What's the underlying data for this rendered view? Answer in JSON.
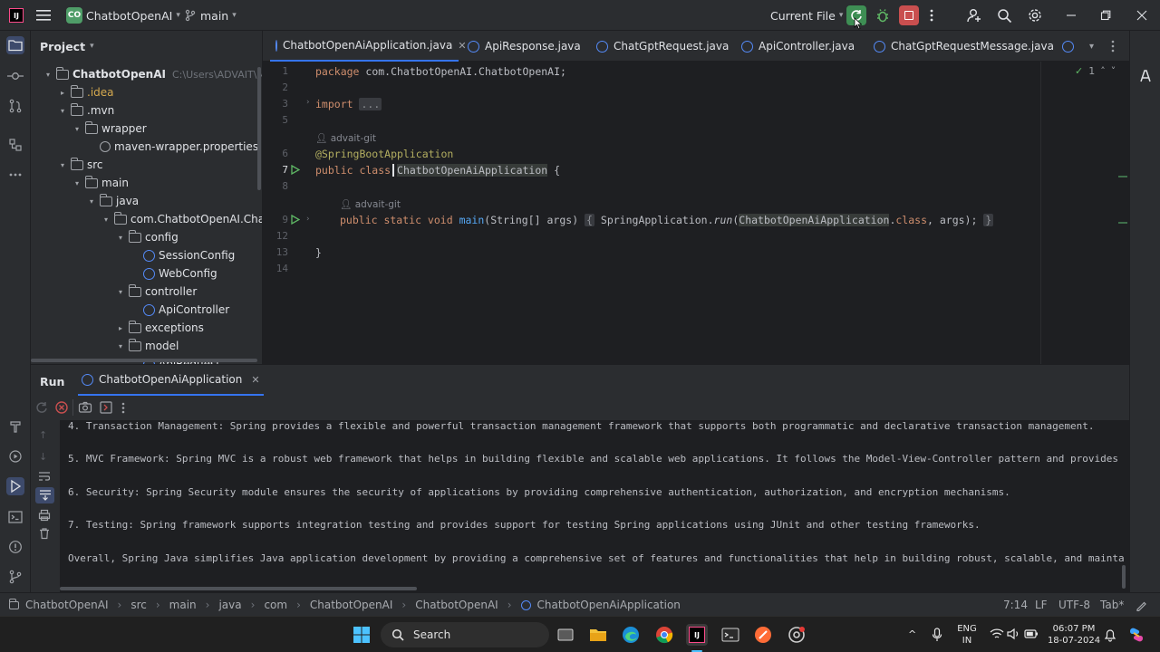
{
  "titlebar": {
    "project_badge": "CO",
    "project_name": "ChatbotOpenAI",
    "branch": "main",
    "run_config": "Current File"
  },
  "project_panel": {
    "title": "Project",
    "tree": [
      {
        "label": "ChatbotOpenAI",
        "hint": "C:\\Users\\ADVAIT\\Music",
        "indent": 0,
        "kind": "folder",
        "open": true
      },
      {
        "label": ".idea",
        "indent": 1,
        "kind": "folder",
        "open": false,
        "accent": true
      },
      {
        "label": ".mvn",
        "indent": 1,
        "kind": "folder",
        "open": true
      },
      {
        "label": "wrapper",
        "indent": 2,
        "kind": "folder",
        "open": true
      },
      {
        "label": "maven-wrapper.properties",
        "indent": 3,
        "kind": "settings",
        "open": null
      },
      {
        "label": "src",
        "indent": 1,
        "kind": "folder",
        "open": true
      },
      {
        "label": "main",
        "indent": 2,
        "kind": "folder",
        "open": true
      },
      {
        "label": "java",
        "indent": 3,
        "kind": "folder",
        "open": true
      },
      {
        "label": "com.ChatbotOpenAI.Chatbot",
        "indent": 4,
        "kind": "folder",
        "open": true
      },
      {
        "label": "config",
        "indent": 5,
        "kind": "folder",
        "open": true
      },
      {
        "label": "SessionConfig",
        "indent": 6,
        "kind": "class",
        "open": null
      },
      {
        "label": "WebConfig",
        "indent": 6,
        "kind": "class",
        "open": null
      },
      {
        "label": "controller",
        "indent": 5,
        "kind": "folder",
        "open": true
      },
      {
        "label": "ApiController",
        "indent": 6,
        "kind": "class",
        "open": null
      },
      {
        "label": "exceptions",
        "indent": 5,
        "kind": "folder",
        "open": false
      },
      {
        "label": "model",
        "indent": 5,
        "kind": "folder",
        "open": true
      },
      {
        "label": "ApiRequest",
        "indent": 6,
        "kind": "class",
        "open": null
      }
    ]
  },
  "tabs": [
    {
      "label": "ChatbotOpenAiApplication.java",
      "active": true
    },
    {
      "label": "ApiResponse.java",
      "active": false
    },
    {
      "label": "ChatGptRequest.java",
      "active": false
    },
    {
      "label": "ApiController.java",
      "active": false
    },
    {
      "label": "ChatGptRequestMessage.java",
      "active": false
    }
  ],
  "editor": {
    "inspection_count": "1",
    "line_numbers": [
      "1",
      "2",
      "3",
      "5",
      "6",
      "7",
      "8",
      "9",
      "12",
      "13",
      "14"
    ],
    "author": "advait-git",
    "code": {
      "pkg_kw": "package",
      "pkg_name": " com.ChatbotOpenAI.ChatbotOpenAI;",
      "import_kw": "import",
      "import_fold": "...",
      "annotation": "@SpringBootApplication",
      "cls_kw": "public class ",
      "cls_name": "ChatbotOpenAiApplication",
      "cls_brace": " {",
      "main_kw": "public static void ",
      "main_name": "main",
      "main_args": "(String[] args) ",
      "main_fold_open": "{",
      "main_body_1": " SpringApplication.",
      "main_run": "run",
      "main_body_2": "(",
      "main_body_cls": "ChatbotOpenAiApplication",
      "main_body_3": ".",
      "main_body_kw": "class",
      "main_body_4": ", args); ",
      "main_fold_close": "}",
      "closing": "}"
    }
  },
  "run_panel": {
    "title": "Run",
    "tab_label": "ChatbotOpenAiApplication",
    "console": [
      "4. Transaction Management: Spring provides a flexible and powerful transaction management framework that supports both programmatic and declarative transaction management.",
      "5. MVC Framework: Spring MVC is a robust web framework that helps in building flexible and scalable web applications. It follows the Model-View-Controller pattern and provides",
      "6. Security: Spring Security module ensures the security of applications by providing comprehensive authentication, authorization, and encryption mechanisms.",
      "7. Testing: Spring framework supports integration testing and provides support for testing Spring applications using JUnit and other testing frameworks.",
      "Overall, Spring Java simplifies Java application development by providing a comprehensive set of features and functionalities that help in building robust, scalable, and mainta"
    ]
  },
  "statusbar": {
    "breadcrumbs": [
      "ChatbotOpenAI",
      "src",
      "main",
      "java",
      "com",
      "ChatbotOpenAI",
      "ChatbotOpenAI",
      "ChatbotOpenAiApplication"
    ],
    "caret": "7:14",
    "line_sep": "LF",
    "encoding": "UTF-8",
    "indent": "Tab*"
  },
  "taskbar": {
    "search_placeholder": "Search",
    "lang_1": "ENG",
    "lang_2": "IN",
    "time": "06:07 PM",
    "date": "18-07-2024"
  },
  "colors": {
    "accent": "#3574f0",
    "run_green": "#3e8e54",
    "stop_red": "#c94f4f",
    "class_blue": "#548af7"
  }
}
